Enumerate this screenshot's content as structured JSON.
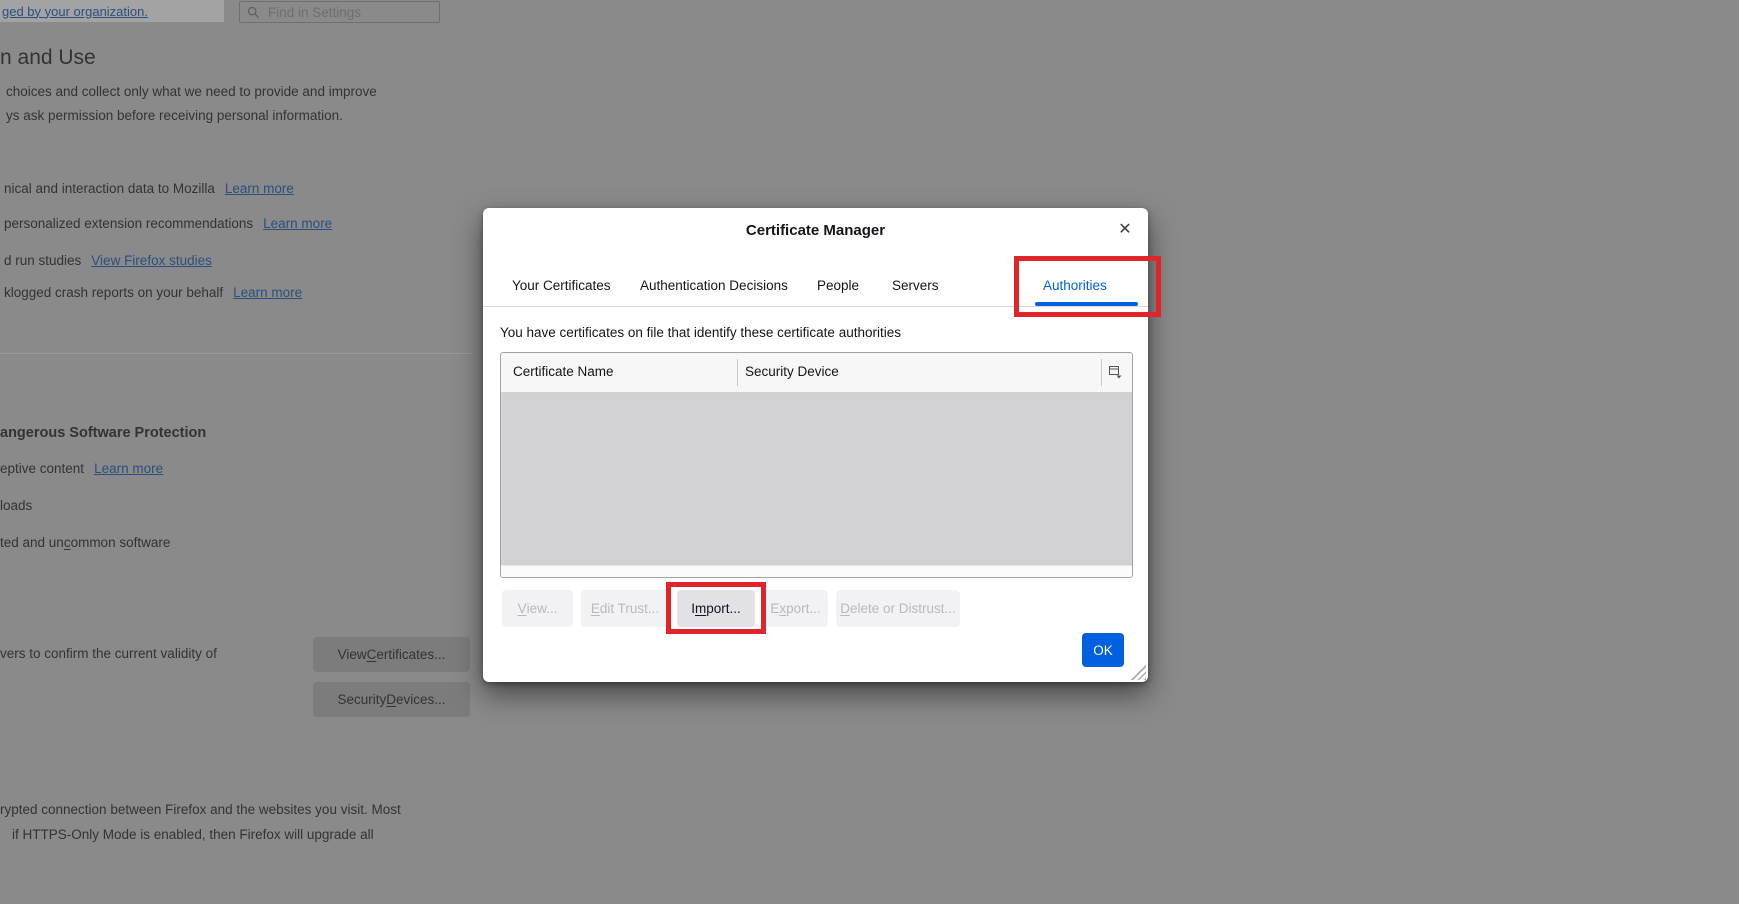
{
  "annotation": {
    "color": "#e0242a"
  },
  "background": {
    "notice": {
      "link": "ged by your organization."
    },
    "search": {
      "placeholder": "Find in Settings"
    },
    "heading": "n and Use",
    "intro_lines": [
      "choices and collect only what we need to provide and improve",
      "ys ask permission before receiving personal information."
    ],
    "data_rows": [
      {
        "text": "nical and interaction data to Mozilla",
        "link": "Learn more"
      },
      {
        "text": "personalized extension recommendations",
        "link": "Learn more"
      },
      {
        "text": "d run studies",
        "link": "View Firefox studies"
      },
      {
        "text": "klogged crash reports on your behalf",
        "link": "Learn more"
      }
    ],
    "security_heading": "angerous Software Protection",
    "security_rows": [
      {
        "text": "eptive content",
        "link": "Learn more"
      },
      {
        "text": "loads"
      },
      {
        "pre": "ted and un",
        "key": "c",
        "post": "ommon software"
      }
    ],
    "certs_row": {
      "text": "vers to confirm the current validity of"
    },
    "cert_buttons": [
      {
        "pre": "View ",
        "key": "C",
        "post": "ertificates..."
      },
      {
        "pre": "Security ",
        "key": "D",
        "post": "evices..."
      }
    ],
    "https_lines": [
      "rypted connection between Firefox and the websites you visit. Most",
      "if HTTPS-Only Mode is enabled, then Firefox will upgrade all"
    ]
  },
  "dialog": {
    "title": "Certificate Manager",
    "close_icon": "✕",
    "tabs": [
      {
        "label": "Your Certificates",
        "active": false
      },
      {
        "label": "Authentication Decisions",
        "active": false
      },
      {
        "label": "People",
        "active": false
      },
      {
        "label": "Servers",
        "active": false
      },
      {
        "label": "Authorities",
        "active": true
      }
    ],
    "description": "You have certificates on file that identify these certificate authorities",
    "table": {
      "columns": [
        "Certificate Name",
        "Security Device"
      ],
      "rows": []
    },
    "action_buttons": [
      {
        "pre": "",
        "key": "V",
        "post": "iew...",
        "enabled": false
      },
      {
        "pre": "",
        "key": "E",
        "post": "dit Trust...",
        "enabled": false
      },
      {
        "pre": "I",
        "key": "m",
        "post": "port...",
        "enabled": true
      },
      {
        "pre": "E",
        "key": "x",
        "post": "port...",
        "enabled": false
      },
      {
        "pre": "",
        "key": "D",
        "post": "elete or Distrust...",
        "enabled": false
      }
    ],
    "ok_label": "OK",
    "accent_color": "#0060df"
  }
}
